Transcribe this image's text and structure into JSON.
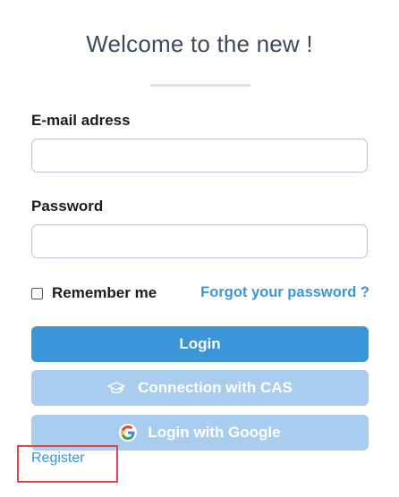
{
  "header": {
    "title": "Welcome to the new !"
  },
  "form": {
    "email_label": "E-mail adress",
    "email_value": "",
    "email_placeholder": "",
    "password_label": "Password",
    "password_value": "",
    "password_placeholder": "",
    "remember_label": "Remember me",
    "remember_checked": false,
    "forgot_label": "Forgot your password ?"
  },
  "buttons": {
    "login_label": "Login",
    "cas_label": "Connection with CAS",
    "cas_icon": "graduation-cap-icon",
    "google_label": "Login with Google",
    "google_icon": "google-icon"
  },
  "footer": {
    "register_label": "Register"
  },
  "colors": {
    "primary": "#3b95d9",
    "secondary_button": "#a8cdef",
    "highlight": "#e04545",
    "title_text": "#3c4a5c"
  }
}
